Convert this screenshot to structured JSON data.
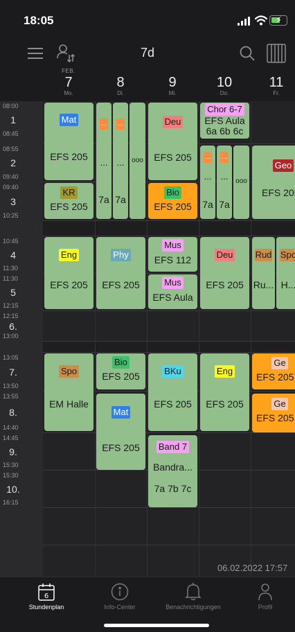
{
  "status_bar": {
    "time": "18:05"
  },
  "header": {
    "title": "7d"
  },
  "days": [
    {
      "month": "FEB.",
      "num": "7",
      "name": "Mo."
    },
    {
      "month": "",
      "num": "8",
      "name": "Di."
    },
    {
      "month": "",
      "num": "9",
      "name": "Mi."
    },
    {
      "month": "",
      "num": "10",
      "name": "Do."
    },
    {
      "month": "",
      "num": "11",
      "name": "Fr."
    }
  ],
  "periods": [
    {
      "start": "08:00",
      "num": "1",
      "end": "08:45"
    },
    {
      "start": "08:55",
      "num": "2",
      "end": "09:40"
    },
    {
      "start": "09:40",
      "num": "3",
      "end": "10:25"
    },
    {
      "start": "10:45",
      "num": "4",
      "end": "11:30"
    },
    {
      "start": "11:30",
      "num": "5",
      "end": "12:15"
    },
    {
      "start": "12:15",
      "num": "6.",
      "end": "13:00"
    },
    {
      "start": "13:05",
      "num": "7.",
      "end": "13:50"
    },
    {
      "start": "13:55",
      "num": "8.",
      "end": "14:40"
    },
    {
      "start": "14:45",
      "num": "9.",
      "end": "15:30"
    },
    {
      "start": "15:30",
      "num": "10.",
      "end": "16:15"
    }
  ],
  "lessons": {
    "mon_mat": {
      "subject": "Mat",
      "room": "EFS 205",
      "color": "#2f7ff0"
    },
    "mon_kr": {
      "subject": "KR",
      "room": "EFS 205",
      "color": "#a39a2e"
    },
    "mon_eng": {
      "subject": "Eng",
      "room": "EFS 205",
      "color": "#f7f72a"
    },
    "mon_spo": {
      "subject": "Spo",
      "room": "EM Halle",
      "color": "#c98d4c"
    },
    "tue_a": {
      "tag": "...",
      "text": "...",
      "group": "7a",
      "color": "#ff8a3a"
    },
    "tue_b": {
      "tag": "...",
      "text": "...",
      "group": "7a",
      "color": "#ff8a3a"
    },
    "tue_more": {
      "text": "ooo"
    },
    "tue_phy": {
      "subject": "Phy",
      "room": "EFS 205",
      "color": "#6aa9b3"
    },
    "tue_bio": {
      "subject": "Bio",
      "room": "EFS 205",
      "color": "#3cc16a"
    },
    "tue_mat": {
      "subject": "Mat",
      "room": "EFS 205",
      "color": "#2f7ff0"
    },
    "wed_deu": {
      "subject": "Deu",
      "room": "EFS 205",
      "color": "#ef7f7f"
    },
    "wed_bio": {
      "subject": "Bio",
      "room": "EFS 205",
      "color": "#3cc16a"
    },
    "wed_mus1": {
      "subject": "Mus",
      "room": "EFS 112",
      "color": "#f2a2f0"
    },
    "wed_mus2": {
      "subject": "Mus",
      "room": "EFS Aula",
      "color": "#f2a2f0"
    },
    "wed_bku": {
      "subject": "BKu",
      "room": "EFS 205",
      "color": "#4fd6ea"
    },
    "wed_band": {
      "subject": "Band 7",
      "room": "Bandra...",
      "group": "7a 7b 7c",
      "color": "#f2a2f0"
    },
    "thu_chor": {
      "subject": "Chor 6-7",
      "room": "EFS Aula",
      "group": "6a 6b 6c",
      "color": "#f2a2f0"
    },
    "thu_a": {
      "tag": "...",
      "text": "...",
      "group": "7a",
      "color": "#ff8a3a"
    },
    "thu_b": {
      "tag": "...",
      "text": "...",
      "group": "7a",
      "color": "#ff8a3a"
    },
    "thu_more": {
      "text": "ooo"
    },
    "thu_deu": {
      "subject": "Deu",
      "room": "EFS 205",
      "color": "#ef7f7f"
    },
    "thu_eng": {
      "subject": "Eng",
      "room": "EFS 205",
      "color": "#f7f72a"
    },
    "fri_geo": {
      "subject": "Geo",
      "room": "EFS 205",
      "color": "#b3252a"
    },
    "fri_rud": {
      "subject": "Rud",
      "room": "Ru...",
      "color": "#c98d4c"
    },
    "fri_spo": {
      "subject": "Spo",
      "room": "H...",
      "color": "#c98d4c"
    },
    "fri_ge1": {
      "subject": "Ge",
      "room": "EFS 205",
      "color": "#f0c8b4"
    },
    "fri_ge2": {
      "subject": "Ge",
      "room": "EFS 205",
      "color": "#f0c8b4"
    }
  },
  "date_stamp": "06.02.2022 17:57",
  "tabs": [
    {
      "label": "Stundenplan",
      "icon": "calendar-icon",
      "day": "6"
    },
    {
      "label": "Info-Center",
      "icon": "info-icon"
    },
    {
      "label": "Benachrichtigungen",
      "icon": "bell-icon"
    },
    {
      "label": "Profil",
      "icon": "profile-icon"
    }
  ]
}
